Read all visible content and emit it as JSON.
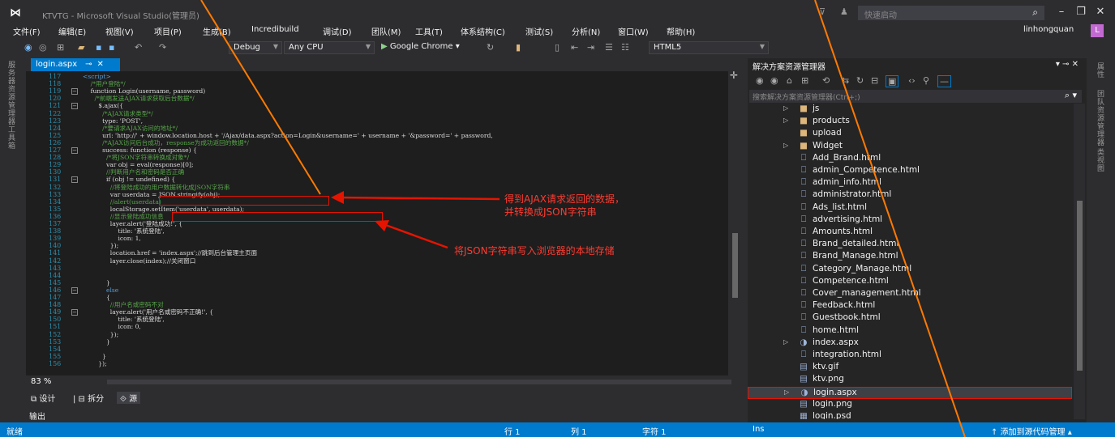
{
  "window": {
    "title": "KTVTG - Microsoft Visual Studio(管理员)",
    "quick_launch": "快速启动",
    "username": "linhongquan",
    "avatar_letter": "L"
  },
  "menu": [
    "文件(F)",
    "编辑(E)",
    "视图(V)",
    "项目(P)",
    "生成(B)",
    "Incredibuild",
    "调试(D)",
    "团队(M)",
    "工具(T)",
    "体系结构(C)",
    "测试(S)",
    "分析(N)",
    "窗口(W)",
    "帮助(H)"
  ],
  "toolbar": {
    "config": "Debug",
    "platform": "Any CPU",
    "browser": "Google Chrome",
    "schema": "HTML5"
  },
  "left_rail": [
    "服务器资源管理器",
    "工具箱"
  ],
  "right_rail": [
    "属性",
    "团队资源管理器",
    "类视图"
  ],
  "editor": {
    "tab_label": "login.aspx",
    "zoom": "83 %",
    "view_tabs": [
      "设计",
      "拆分",
      "源"
    ],
    "lines": [
      {
        "n": "117",
        "t": "<script>",
        "cls": "kw"
      },
      {
        "n": "118",
        "t": "    /*用户登陆*/",
        "cls": "cmt"
      },
      {
        "n": "119",
        "t": "    function Login(username, password)",
        "cls": ""
      },
      {
        "n": "120",
        "t": "      /*前端发送AJAX请求获取后台数据*/",
        "cls": "cmt"
      },
      {
        "n": "121",
        "t": "        $.ajax({",
        "cls": ""
      },
      {
        "n": "122",
        "t": "          /*AJAX请求类型*/",
        "cls": "cmt"
      },
      {
        "n": "123",
        "t": "          type: 'POST',",
        "cls": ""
      },
      {
        "n": "124",
        "t": "          /*要请求AJAX访问的地址*/",
        "cls": "cmt"
      },
      {
        "n": "125",
        "t": "          url: 'http://' + window.location.host + '/Ajax/data.aspx?action=Login&username=' + username + '&password=' + password,",
        "cls": ""
      },
      {
        "n": "126",
        "t": "          /*AJAX访问后台成功，response为成功返回的数据*/",
        "cls": "cmt"
      },
      {
        "n": "127",
        "t": "          success: function (response) {",
        "cls": ""
      },
      {
        "n": "128",
        "t": "            /*将JSON字符串转换成对象*/",
        "cls": "cmt"
      },
      {
        "n": "129",
        "t": "            var obj = eval(response)[0];",
        "cls": ""
      },
      {
        "n": "130",
        "t": "            //判断用户名和密码是否正确",
        "cls": "cmt"
      },
      {
        "n": "131",
        "t": "            if (obj != undefined) {",
        "cls": ""
      },
      {
        "n": "132",
        "t": "              //将登陆成功的用户数据转化成JSON字符串",
        "cls": "cmt"
      },
      {
        "n": "133",
        "t": "              var userdata = JSON.stringify(obj);",
        "cls": ""
      },
      {
        "n": "134",
        "t": "              //alert(userdata)",
        "cls": "cmt"
      },
      {
        "n": "135",
        "t": "              localStorage.setItem('userdata', userdata);",
        "cls": ""
      },
      {
        "n": "136",
        "t": "              //显示登陆成功信息",
        "cls": "cmt"
      },
      {
        "n": "137",
        "t": "              layer.alert('登陆成功!', {",
        "cls": ""
      },
      {
        "n": "138",
        "t": "                  title: '系统登陆',",
        "cls": ""
      },
      {
        "n": "139",
        "t": "                  icon: 1,",
        "cls": ""
      },
      {
        "n": "140",
        "t": "              });",
        "cls": ""
      },
      {
        "n": "141",
        "t": "              location.href = 'index.aspx';//跳到后台管理主页面",
        "cls": ""
      },
      {
        "n": "142",
        "t": "              layer.close(index);//关闭窗口",
        "cls": ""
      },
      {
        "n": "143",
        "t": "",
        "cls": ""
      },
      {
        "n": "144",
        "t": "",
        "cls": ""
      },
      {
        "n": "145",
        "t": "            }",
        "cls": ""
      },
      {
        "n": "146",
        "t": "            else",
        "cls": "kw"
      },
      {
        "n": "147",
        "t": "            {",
        "cls": ""
      },
      {
        "n": "148",
        "t": "              //用户名或密码不对",
        "cls": "cmt"
      },
      {
        "n": "149",
        "t": "              layer.alert('用户名或密码不正确!', {",
        "cls": ""
      },
      {
        "n": "150",
        "t": "                  title: '系统登陆',",
        "cls": ""
      },
      {
        "n": "151",
        "t": "                  icon: 0,",
        "cls": ""
      },
      {
        "n": "152",
        "t": "              });",
        "cls": ""
      },
      {
        "n": "153",
        "t": "            }",
        "cls": ""
      },
      {
        "n": "154",
        "t": "",
        "cls": ""
      },
      {
        "n": "155",
        "t": "          }",
        "cls": ""
      },
      {
        "n": "156",
        "t": "        });",
        "cls": ""
      }
    ]
  },
  "solution_explorer": {
    "title": "解决方案资源管理器",
    "search_placeholder": "搜索解决方案资源管理器(Ctrl+;)",
    "items": [
      {
        "label": "js",
        "kind": "folder",
        "exp": "▷"
      },
      {
        "label": "products",
        "kind": "folder",
        "exp": "▷"
      },
      {
        "label": "upload",
        "kind": "folder",
        "exp": ""
      },
      {
        "label": "Widget",
        "kind": "folder",
        "exp": "▷"
      },
      {
        "label": "Add_Brand.html",
        "kind": "file",
        "exp": ""
      },
      {
        "label": "admin_Competence.html",
        "kind": "file",
        "exp": ""
      },
      {
        "label": "admin_info.html",
        "kind": "file",
        "exp": ""
      },
      {
        "label": "administrator.html",
        "kind": "file",
        "exp": ""
      },
      {
        "label": "Ads_list.html",
        "kind": "file",
        "exp": ""
      },
      {
        "label": "advertising.html",
        "kind": "file",
        "exp": ""
      },
      {
        "label": "Amounts.html",
        "kind": "file",
        "exp": ""
      },
      {
        "label": "Brand_detailed.html",
        "kind": "file",
        "exp": ""
      },
      {
        "label": "Brand_Manage.html",
        "kind": "file",
        "exp": ""
      },
      {
        "label": "Category_Manage.html",
        "kind": "file",
        "exp": ""
      },
      {
        "label": "Competence.html",
        "kind": "file",
        "exp": ""
      },
      {
        "label": "Cover_management.html",
        "kind": "file",
        "exp": ""
      },
      {
        "label": "Feedback.html",
        "kind": "file",
        "exp": ""
      },
      {
        "label": "Guestbook.html",
        "kind": "file",
        "exp": ""
      },
      {
        "label": "home.html",
        "kind": "file",
        "exp": ""
      },
      {
        "label": "index.aspx",
        "kind": "aspx",
        "exp": "▷"
      },
      {
        "label": "integration.html",
        "kind": "file",
        "exp": ""
      },
      {
        "label": "ktv.gif",
        "kind": "image",
        "exp": ""
      },
      {
        "label": "ktv.png",
        "kind": "image",
        "exp": ""
      },
      {
        "label": "login.aspx",
        "kind": "aspx",
        "exp": "▷",
        "selected": true
      },
      {
        "label": "login.png",
        "kind": "image",
        "exp": ""
      },
      {
        "label": "login.psd",
        "kind": "psd",
        "exp": ""
      }
    ]
  },
  "output_tab": "输出",
  "status": {
    "ready": "就绪",
    "line": "行 1",
    "col": "列 1",
    "char": "字符 1",
    "mode": "Ins",
    "source_control": "添加到源代码管理"
  },
  "annotations": {
    "note1": "得到AJAX请求返回的数据，",
    "note1b": "并转换成JSON字符串",
    "note2": "将JSON字符串写入浏览器的本地存储"
  },
  "colors": {
    "accent": "#007acc",
    "annotation": "#e51400"
  }
}
